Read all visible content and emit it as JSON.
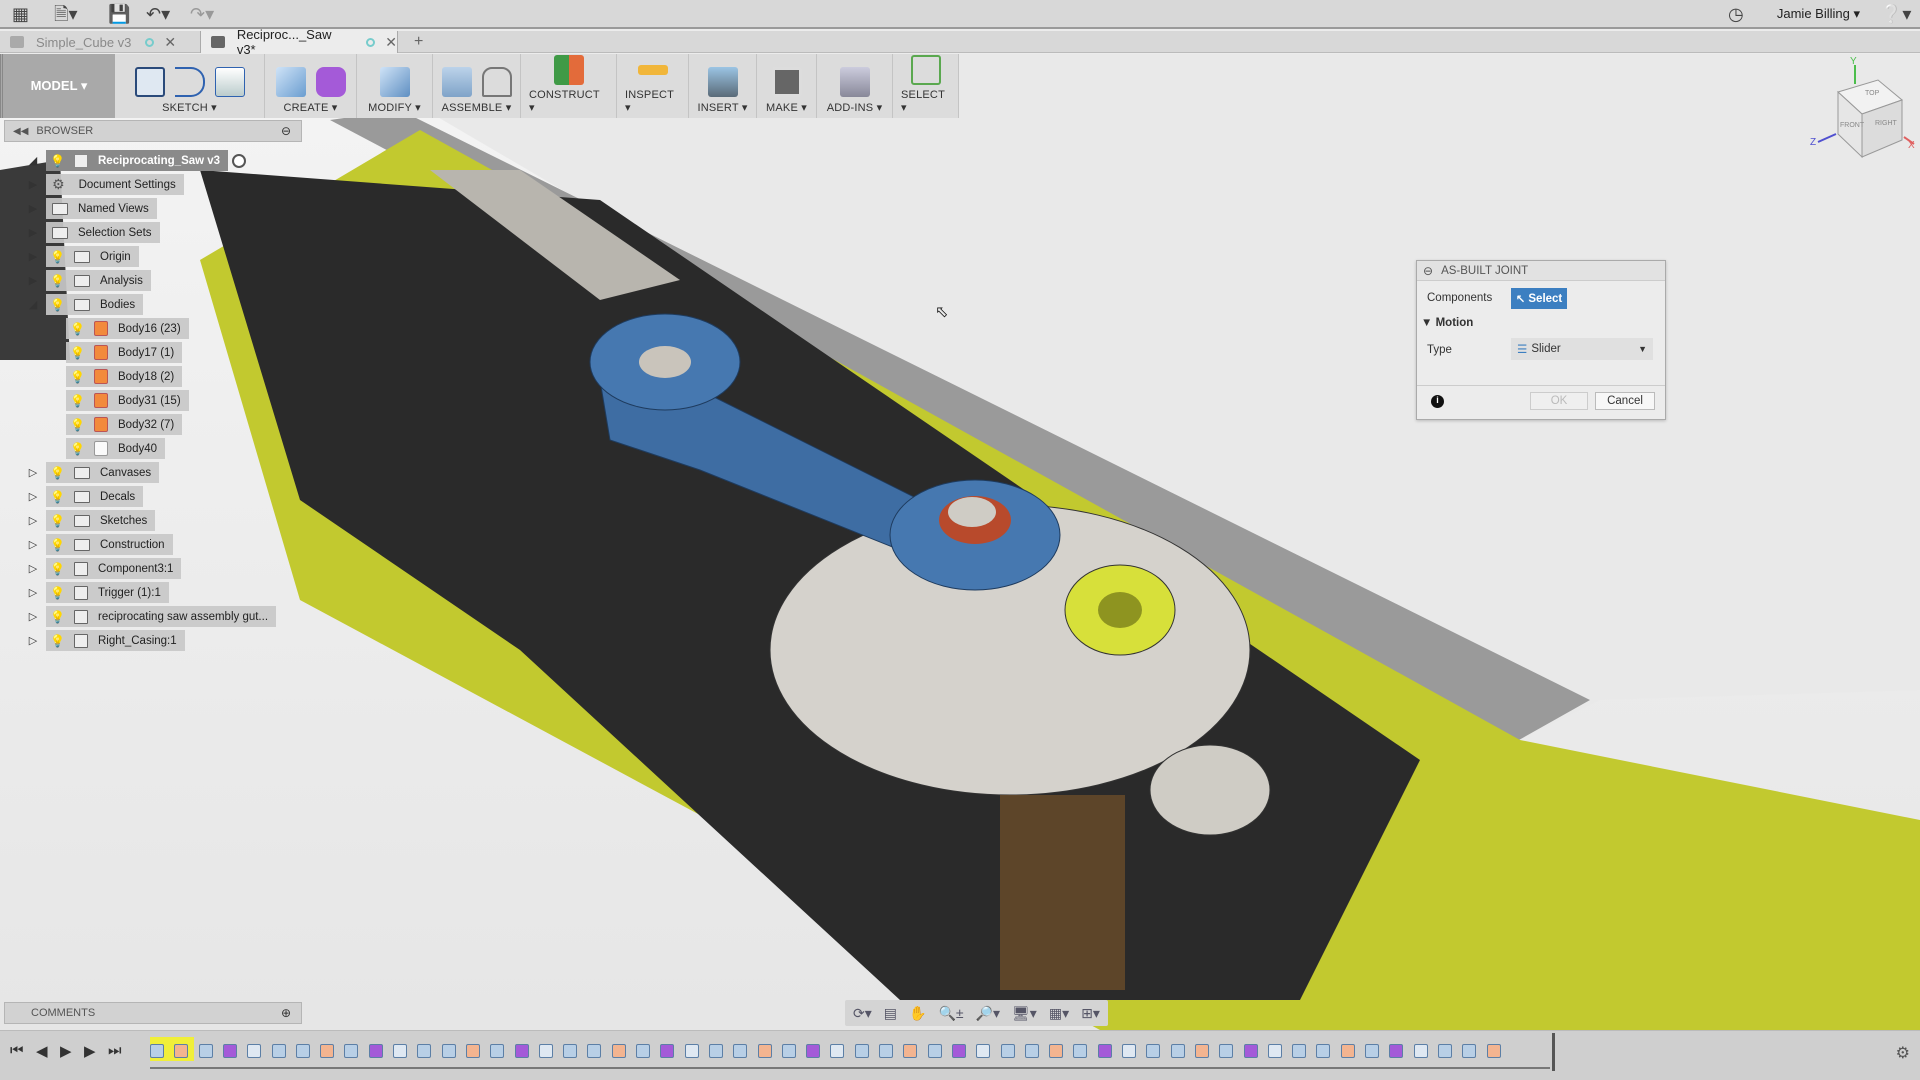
{
  "app": {
    "user": "Jamie Billing",
    "icons": [
      "apps-grid-icon",
      "file-icon",
      "save-icon",
      "undo-icon",
      "redo-icon",
      "clock-icon",
      "help-icon"
    ]
  },
  "tabs": [
    {
      "label": "Simple_Cube v3",
      "active": false
    },
    {
      "label": "Reciproc..._Saw v3*",
      "active": true
    }
  ],
  "toolbar": {
    "workspace": "MODEL ▾",
    "groups": [
      {
        "label": "SKETCH ▾"
      },
      {
        "label": "CREATE ▾"
      },
      {
        "label": "MODIFY ▾"
      },
      {
        "label": "ASSEMBLE ▾"
      },
      {
        "label": "CONSTRUCT ▾"
      },
      {
        "label": "INSPECT ▾"
      },
      {
        "label": "INSERT ▾"
      },
      {
        "label": "MAKE ▾"
      },
      {
        "label": "ADD-INS ▾"
      },
      {
        "label": "SELECT ▾"
      }
    ]
  },
  "browser": {
    "title": "BROWSER",
    "root": "Reciprocating_Saw v3",
    "items": [
      {
        "label": "Document Settings"
      },
      {
        "label": "Named Views"
      },
      {
        "label": "Selection Sets"
      },
      {
        "label": "Origin"
      },
      {
        "label": "Analysis"
      },
      {
        "label": "Bodies"
      },
      {
        "label": "Body16 (23)"
      },
      {
        "label": "Body17 (1)"
      },
      {
        "label": "Body18 (2)"
      },
      {
        "label": "Body31 (15)"
      },
      {
        "label": "Body32 (7)"
      },
      {
        "label": "Body40"
      },
      {
        "label": "Canvases"
      },
      {
        "label": "Decals"
      },
      {
        "label": "Sketches"
      },
      {
        "label": "Construction"
      },
      {
        "label": "Component3:1"
      },
      {
        "label": "Trigger (1):1"
      },
      {
        "label": "reciprocating saw assembly gut..."
      },
      {
        "label": "Right_Casing:1"
      }
    ]
  },
  "comments": {
    "title": "COMMENTS"
  },
  "dialog": {
    "title": "AS-BUILT JOINT",
    "components_label": "Components",
    "select_label": "Select",
    "motion_label": "Motion",
    "type_label": "Type",
    "type_value": "Slider",
    "ok": "OK",
    "cancel": "Cancel"
  },
  "viewcube": {
    "top": "TOP",
    "front": "FRONT",
    "right": "RIGHT",
    "x": "X",
    "y": "Y",
    "z": "Z"
  },
  "playback": {
    "first": "⏮",
    "prev": "◀",
    "play": "▶",
    "next": "▶",
    "last": "⏭"
  }
}
